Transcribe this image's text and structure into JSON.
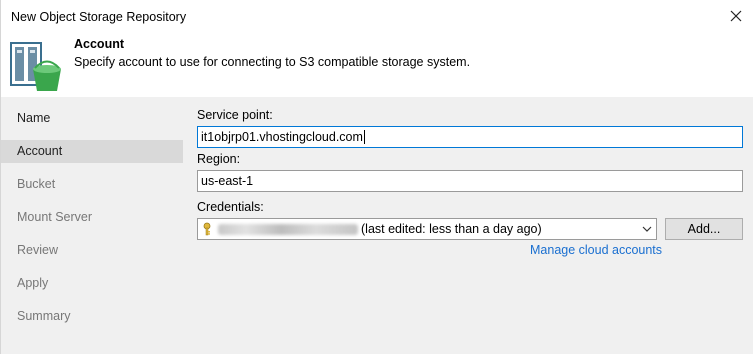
{
  "window": {
    "title": "New Object Storage Repository"
  },
  "header": {
    "title": "Account",
    "description": "Specify account to use for connecting to S3 compatible storage system."
  },
  "sidebar": {
    "items": [
      {
        "label": "Name",
        "state": "done"
      },
      {
        "label": "Account",
        "state": "active"
      },
      {
        "label": "Bucket",
        "state": "pending"
      },
      {
        "label": "Mount Server",
        "state": "pending"
      },
      {
        "label": "Review",
        "state": "pending"
      },
      {
        "label": "Apply",
        "state": "pending"
      },
      {
        "label": "Summary",
        "state": "pending"
      }
    ]
  },
  "form": {
    "service_point_label": "Service point:",
    "service_point_value": "it1objrp01.vhostingcloud.com",
    "region_label": "Region:",
    "region_value": "us-east-1",
    "credentials_label": "Credentials:",
    "credentials_value": "(last edited: less than a day ago)",
    "add_button": "Add...",
    "manage_link": "Manage cloud accounts"
  },
  "icons": {
    "close": "close-icon",
    "logo": "object-storage-bucket-icon",
    "credential": "key-icon",
    "dropdown": "chevron-down-icon"
  },
  "colors": {
    "link": "#1a6fd0",
    "focus_border": "#0078d7",
    "panel_bg": "#f0f0f0",
    "active_nav": "#d9d9d9"
  }
}
